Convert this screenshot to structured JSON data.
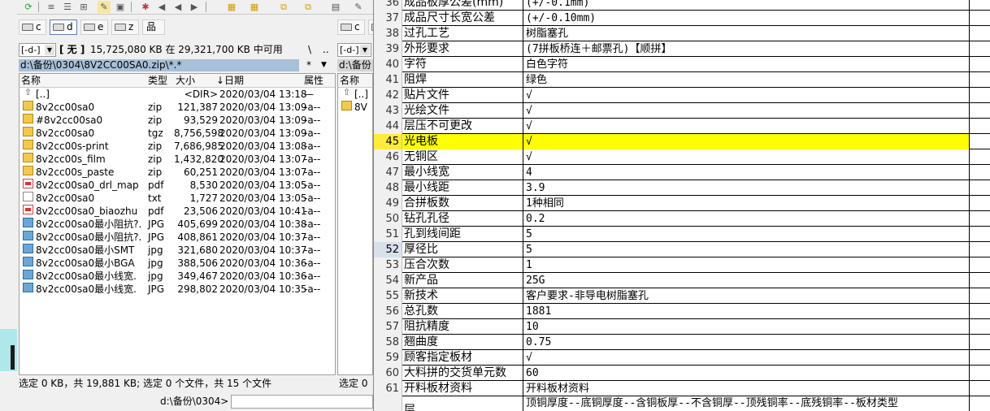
{
  "file_manager": {
    "drives_left": [
      "c",
      "d",
      "e",
      "z"
    ],
    "drives_right": [
      "c",
      "z"
    ],
    "drive_combo": "[-d-]",
    "drive_combo_right": "[-d-]",
    "drive_label": "[ 无 ]",
    "free_space": "15,725,080 KB 在 29,321,700 KB 中可用",
    "root_btn": "\\",
    "up_btn": "..",
    "path": "d:\\备份\\0304\\8V2CC00SA0.zip\\*.*",
    "path_right": "d:\\备份",
    "filter_star": "*",
    "filter_arrow": "▼",
    "columns": {
      "name": "名称",
      "ext": "类型",
      "size": "大小",
      "date": "↓日期",
      "attr": "属性"
    },
    "right_column_name": "名称",
    "right_up": "[..]",
    "right_first": "8V",
    "files": [
      {
        "name": "[..]",
        "ext": "",
        "size": "<DIR>",
        "date": "2020/03/04 13:18",
        "attr": "—",
        "icon": "up"
      },
      {
        "name": "8v2cc00sa0",
        "ext": "zip",
        "size": "121,387",
        "date": "2020/03/04 13:09",
        "attr": "-a--",
        "icon": "zip"
      },
      {
        "name": "#8v2cc00sa0",
        "ext": "zip",
        "size": "93,529",
        "date": "2020/03/04 13:09",
        "attr": "-a--",
        "icon": "zip"
      },
      {
        "name": "8v2cc00sa0",
        "ext": "tgz",
        "size": "8,756,598",
        "date": "2020/03/04 13:09",
        "attr": "-a--",
        "icon": "zip"
      },
      {
        "name": "8v2cc00s-print",
        "ext": "zip",
        "size": "7,686,985",
        "date": "2020/03/04 13:08",
        "attr": "-a--",
        "icon": "zip"
      },
      {
        "name": "8v2cc00s_film",
        "ext": "zip",
        "size": "1,432,820",
        "date": "2020/03/04 13:07",
        "attr": "-a--",
        "icon": "zip"
      },
      {
        "name": "8v2cc00s_paste",
        "ext": "zip",
        "size": "60,251",
        "date": "2020/03/04 13:07",
        "attr": "-a--",
        "icon": "zip"
      },
      {
        "name": "8v2cc00sa0_drl_map",
        "ext": "pdf",
        "size": "8,530",
        "date": "2020/03/04 13:05",
        "attr": "-a--",
        "icon": "pdf"
      },
      {
        "name": "8v2cc00sa0",
        "ext": "txt",
        "size": "1,727",
        "date": "2020/03/04 13:05",
        "attr": "-a--",
        "icon": "txt"
      },
      {
        "name": "8v2cc00sa0_biaozhu",
        "ext": "pdf",
        "size": "23,506",
        "date": "2020/03/04 10:41",
        "attr": "-a--",
        "icon": "pdf"
      },
      {
        "name": "8v2cc00sa0最小阻抗?.",
        "ext": "JPG",
        "size": "405,699",
        "date": "2020/03/04 10:38",
        "attr": "-a--",
        "icon": "jpg"
      },
      {
        "name": "8v2cc00sa0最小阻抗?.",
        "ext": "JPG",
        "size": "408,861",
        "date": "2020/03/04 10:37",
        "attr": "-a--",
        "icon": "jpg"
      },
      {
        "name": "8v2cc00sa0最小SMT",
        "ext": "jpg",
        "size": "321,680",
        "date": "2020/03/04 10:37",
        "attr": "-a--",
        "icon": "jpg"
      },
      {
        "name": "8v2cc00sa0最小BGA",
        "ext": "jpg",
        "size": "388,506",
        "date": "2020/03/04 10:36",
        "attr": "-a--",
        "icon": "jpg"
      },
      {
        "name": "8v2cc00sa0最小线宽.",
        "ext": "jpg",
        "size": "349,467",
        "date": "2020/03/04 10:36",
        "attr": "-a--",
        "icon": "jpg"
      },
      {
        "name": "8v2cc00sa0最小线宽.",
        "ext": "JPG",
        "size": "298,802",
        "date": "2020/03/04 10:35",
        "attr": "-a--",
        "icon": "jpg"
      }
    ],
    "status_left": "选定 0 KB，共 19,881 KB; 选定 0 个文件，共 15 个文件",
    "status_right": "选定 0",
    "cmd_path": "d:\\备份\\0304>"
  },
  "sheet": {
    "rows": [
      {
        "num": "36",
        "a": "成品板厚公差(mm)",
        "b": "(+/-0.1mm)"
      },
      {
        "num": "37",
        "a": "成品尺寸长宽公差",
        "b": "(+/-0.10mm)"
      },
      {
        "num": "38",
        "a": "过孔工艺",
        "b": "树脂塞孔"
      },
      {
        "num": "39",
        "a": "外形要求",
        "b": "(7拼板桥连＋邮票孔)【顺拼】"
      },
      {
        "num": "40",
        "a": "字符",
        "b": "白色字符"
      },
      {
        "num": "41",
        "a": "阻焊",
        "b": "绿色"
      },
      {
        "num": "42",
        "a": "贴片文件",
        "b": "√"
      },
      {
        "num": "43",
        "a": "光绘文件",
        "b": "√"
      },
      {
        "num": "44",
        "a": "层压不可更改",
        "b": "√"
      },
      {
        "num": "45",
        "a": "光电板",
        "b": "√",
        "highlight": true
      },
      {
        "num": "46",
        "a": "无铜区",
        "b": "√"
      },
      {
        "num": "47",
        "a": "最小线宽",
        "b": "4"
      },
      {
        "num": "48",
        "a": "最小线距",
        "b": "3.9"
      },
      {
        "num": "49",
        "a": "合拼板数",
        "b": "1种相同"
      },
      {
        "num": "50",
        "a": "钻孔孔径",
        "b": "0.2"
      },
      {
        "num": "51",
        "a": "孔到线间距",
        "b": "5"
      },
      {
        "num": "52",
        "a": "厚径比",
        "b": "5",
        "selected": true
      },
      {
        "num": "53",
        "a": "压合次数",
        "b": "1"
      },
      {
        "num": "54",
        "a": "新产品",
        "b": "25G"
      },
      {
        "num": "55",
        "a": "新技术",
        "b": "客户要求-非导电树脂塞孔"
      },
      {
        "num": "56",
        "a": "总孔数",
        "b": "1881"
      },
      {
        "num": "57",
        "a": "阻抗精度",
        "b": "10"
      },
      {
        "num": "58",
        "a": "翘曲度",
        "b": "0.75"
      },
      {
        "num": "59",
        "a": "顾客指定板材",
        "b": "√"
      },
      {
        "num": "60",
        "a": "大料拼的交货单元数",
        "b": "60"
      },
      {
        "num": "61",
        "a": "开料板材资料",
        "b": "开料板材资料"
      }
    ],
    "last_row": {
      "num": "",
      "a": "层",
      "b": "顶铜厚度--底铜厚度--含铜板厚--不含铜厚--顶残铜率--底残铜率--板材类型"
    }
  }
}
